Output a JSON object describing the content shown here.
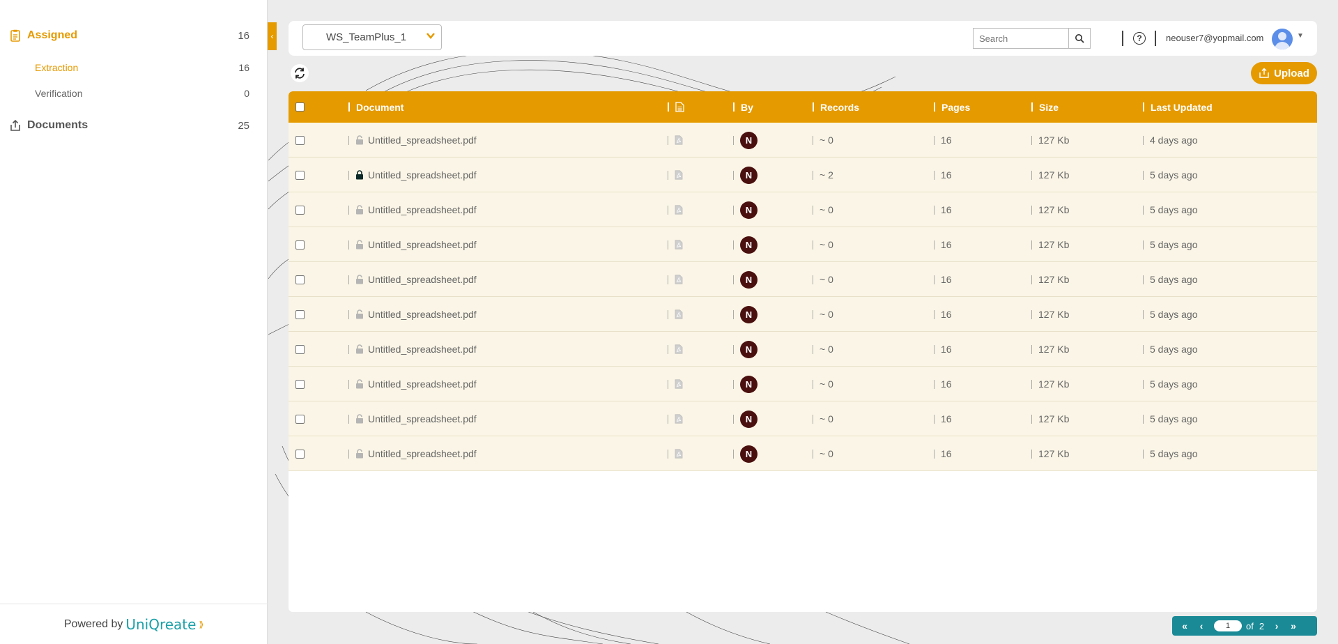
{
  "sidebar": {
    "assigned": {
      "label": "Assigned",
      "count": "16"
    },
    "extraction": {
      "label": "Extraction",
      "count": "16"
    },
    "verification": {
      "label": "Verification",
      "count": "0"
    },
    "documents": {
      "label": "Documents",
      "count": "25"
    },
    "powered_by": "Powered by",
    "brand": "UniQreate"
  },
  "header": {
    "workspace": "WS_TeamPlus_1",
    "search_placeholder": "Search",
    "user_email": "neouser7@yopmail.com"
  },
  "actions": {
    "upload_label": "Upload"
  },
  "table": {
    "columns": [
      "Document",
      "By",
      "Records",
      "Pages",
      "Size",
      "Last Updated"
    ],
    "rows": [
      {
        "document": "Untitled_spreadsheet.pdf",
        "locked": false,
        "by": "N",
        "records": "~ 0",
        "pages": "16",
        "size": "127 Kb",
        "updated": "4 days ago"
      },
      {
        "document": "Untitled_spreadsheet.pdf",
        "locked": true,
        "by": "N",
        "records": "~ 2",
        "pages": "16",
        "size": "127 Kb",
        "updated": "5 days ago"
      },
      {
        "document": "Untitled_spreadsheet.pdf",
        "locked": false,
        "by": "N",
        "records": "~ 0",
        "pages": "16",
        "size": "127 Kb",
        "updated": "5 days ago"
      },
      {
        "document": "Untitled_spreadsheet.pdf",
        "locked": false,
        "by": "N",
        "records": "~ 0",
        "pages": "16",
        "size": "127 Kb",
        "updated": "5 days ago"
      },
      {
        "document": "Untitled_spreadsheet.pdf",
        "locked": false,
        "by": "N",
        "records": "~ 0",
        "pages": "16",
        "size": "127 Kb",
        "updated": "5 days ago"
      },
      {
        "document": "Untitled_spreadsheet.pdf",
        "locked": false,
        "by": "N",
        "records": "~ 0",
        "pages": "16",
        "size": "127 Kb",
        "updated": "5 days ago"
      },
      {
        "document": "Untitled_spreadsheet.pdf",
        "locked": false,
        "by": "N",
        "records": "~ 0",
        "pages": "16",
        "size": "127 Kb",
        "updated": "5 days ago"
      },
      {
        "document": "Untitled_spreadsheet.pdf",
        "locked": false,
        "by": "N",
        "records": "~ 0",
        "pages": "16",
        "size": "127 Kb",
        "updated": "5 days ago"
      },
      {
        "document": "Untitled_spreadsheet.pdf",
        "locked": false,
        "by": "N",
        "records": "~ 0",
        "pages": "16",
        "size": "127 Kb",
        "updated": "5 days ago"
      },
      {
        "document": "Untitled_spreadsheet.pdf",
        "locked": false,
        "by": "N",
        "records": "~ 0",
        "pages": "16",
        "size": "127 Kb",
        "updated": "5 days ago"
      }
    ]
  },
  "pagination": {
    "current": "1",
    "of_label": "of",
    "total": "2"
  },
  "colors": {
    "accent": "#e59a00",
    "row_bg": "#faf5e6",
    "pager": "#1a8a96",
    "avatar_badge": "#4a0f0f"
  }
}
